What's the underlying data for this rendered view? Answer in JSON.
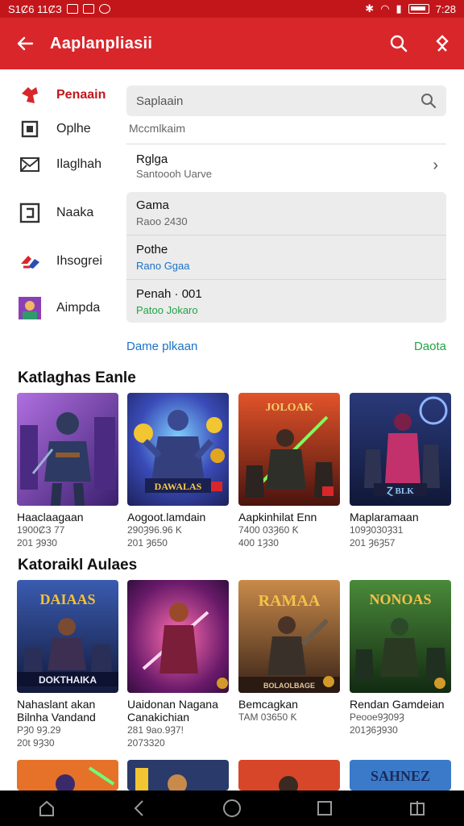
{
  "status_bar": {
    "time_left": "S1Ȼ6 11ȻЗ",
    "time_right": "7:28"
  },
  "app_bar": {
    "title": "Aaplanpliasii"
  },
  "side_menu": [
    {
      "label": "Penaain",
      "active": true,
      "icon": "app-logo-icon"
    },
    {
      "label": "Oplhe",
      "active": false,
      "icon": "square-icon"
    },
    {
      "label": "Ilaglhah",
      "active": false,
      "icon": "mail-icon"
    },
    {
      "label": "Naaka",
      "active": false,
      "icon": "tile-icon"
    },
    {
      "label": "Ihsogrei",
      "active": false,
      "icon": "brand-icon"
    },
    {
      "label": "Aimpda",
      "active": false,
      "icon": "avatar-icon"
    }
  ],
  "search": {
    "placeholder": "Saplaain",
    "hint": "Mccmlkaim"
  },
  "list": {
    "first": {
      "title": "Rglga",
      "subtitle": "Santoooh Uarve"
    },
    "panel": [
      {
        "title": "Gama",
        "subtitle": "Raoo 2430",
        "sub_color": "grey"
      },
      {
        "title": "Pothe",
        "subtitle": "Rano Ggaa",
        "sub_color": "blue"
      },
      {
        "title": "Penah · 001",
        "subtitle": "Patoo Jokaro",
        "sub_color": "green"
      }
    ]
  },
  "links": {
    "left": "Dame plkaan",
    "right": "Daota"
  },
  "section1": {
    "title": "Katlaghas Eanle",
    "cards": [
      {
        "name": "Haaclaagaan",
        "meta1": "1900ȻЗ 77",
        "meta2": "201 Ȝ930"
      },
      {
        "name": "Aogoot.lamdain",
        "meta1": "290Ȝ96.96 K",
        "meta2": "201 Ȝ650"
      },
      {
        "name": "Aapkinhilat Enn",
        "meta1": "7400 03Ȝ60 Ƙ",
        "meta2": "400 1Ȝ30"
      },
      {
        "name": "Maplaramaan",
        "meta1": "109Ȝ030Ȝ31",
        "meta2": "201 Ȝ6Ȝ57"
      }
    ]
  },
  "section2": {
    "title": "Katoraikl Aulaes",
    "cards": [
      {
        "name": "Nahaslant akan",
        "name2": "Bilnha Vandand",
        "meta1": "PȜ0 9Ȝ.29",
        "meta2": "20t 9Ȝ30"
      },
      {
        "name": "Uaidonan Nagana",
        "name2": "Canakichian",
        "meta1": "281 9ao.9Ȝ7!",
        "meta2": "2073320"
      },
      {
        "name": "Bemcagkan",
        "name2": "",
        "meta1": "TAM 03650 Ƙ",
        "meta2": ""
      },
      {
        "name": "Rendan Gamdeian",
        "name2": "",
        "meta1": "Peooe9Ȝ09Ȝ",
        "meta2": "201Ȝ6Ȝ930"
      }
    ]
  },
  "game_art_text": {
    "s1c3": "JOLOAK",
    "s1c2": "DAWALAS",
    "s1c4": "Ɀ BLK",
    "s2c1_top": "DAIAAS",
    "s2c1_bottom": "DOKTHAIKA",
    "s2c3": "RAMAA",
    "s2c3_bottom": "BOLAOLBAGE",
    "s2c4": "NONOAS",
    "s3c4": "SAHNEZ"
  },
  "colors": {
    "brand": "#d9262b",
    "status": "#c3161b",
    "link_blue": "#1a73c8",
    "link_green": "#23a346"
  }
}
